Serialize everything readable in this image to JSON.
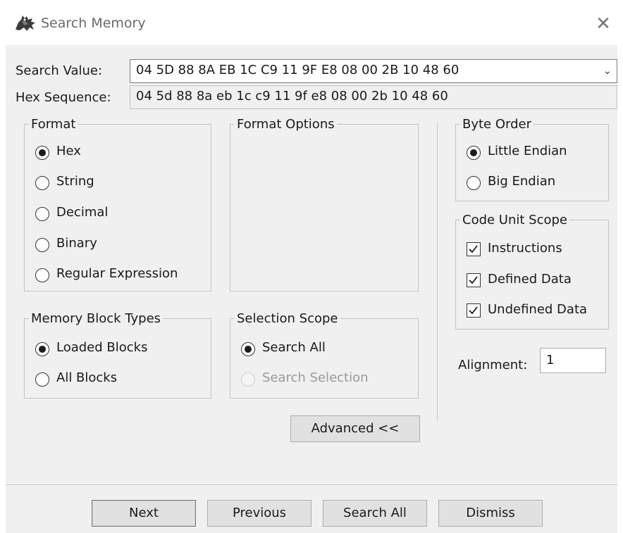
{
  "window": {
    "title": "Search Memory",
    "app_icon": "dragon-icon",
    "close_glyph": "✕"
  },
  "search": {
    "value_label": "Search Value:",
    "value": "04 5D 88 8A EB 1C C9 11 9F E8 08 00 2B 10 48 60",
    "hex_label": "Hex Sequence:",
    "hex_value": "04 5d 88 8a eb 1c c9 11 9f e8 08 00 2b 10 48 60"
  },
  "format": {
    "legend": "Format",
    "options": [
      "Hex",
      "String",
      "Decimal",
      "Binary",
      "Regular Expression"
    ],
    "selected": "Hex"
  },
  "format_options": {
    "legend": "Format Options"
  },
  "byte_order": {
    "legend": "Byte Order",
    "options": [
      "Little Endian",
      "Big Endian"
    ],
    "selected": "Little Endian"
  },
  "code_unit_scope": {
    "legend": "Code Unit Scope",
    "options": [
      {
        "label": "Instructions",
        "checked": true
      },
      {
        "label": "Defined Data",
        "checked": true
      },
      {
        "label": "Undefined Data",
        "checked": true
      }
    ]
  },
  "memory_block_types": {
    "legend": "Memory Block Types",
    "options": [
      "Loaded Blocks",
      "All Blocks"
    ],
    "selected": "Loaded Blocks"
  },
  "selection_scope": {
    "legend": "Selection Scope",
    "options": [
      "Search All",
      "Search Selection"
    ],
    "selected": "Search All",
    "disabled": [
      "Search Selection"
    ]
  },
  "alignment": {
    "label": "Alignment:",
    "value": "1"
  },
  "buttons": {
    "advanced": "Advanced <<",
    "next": "Next",
    "previous": "Previous",
    "search_all": "Search All",
    "dismiss": "Dismiss"
  }
}
